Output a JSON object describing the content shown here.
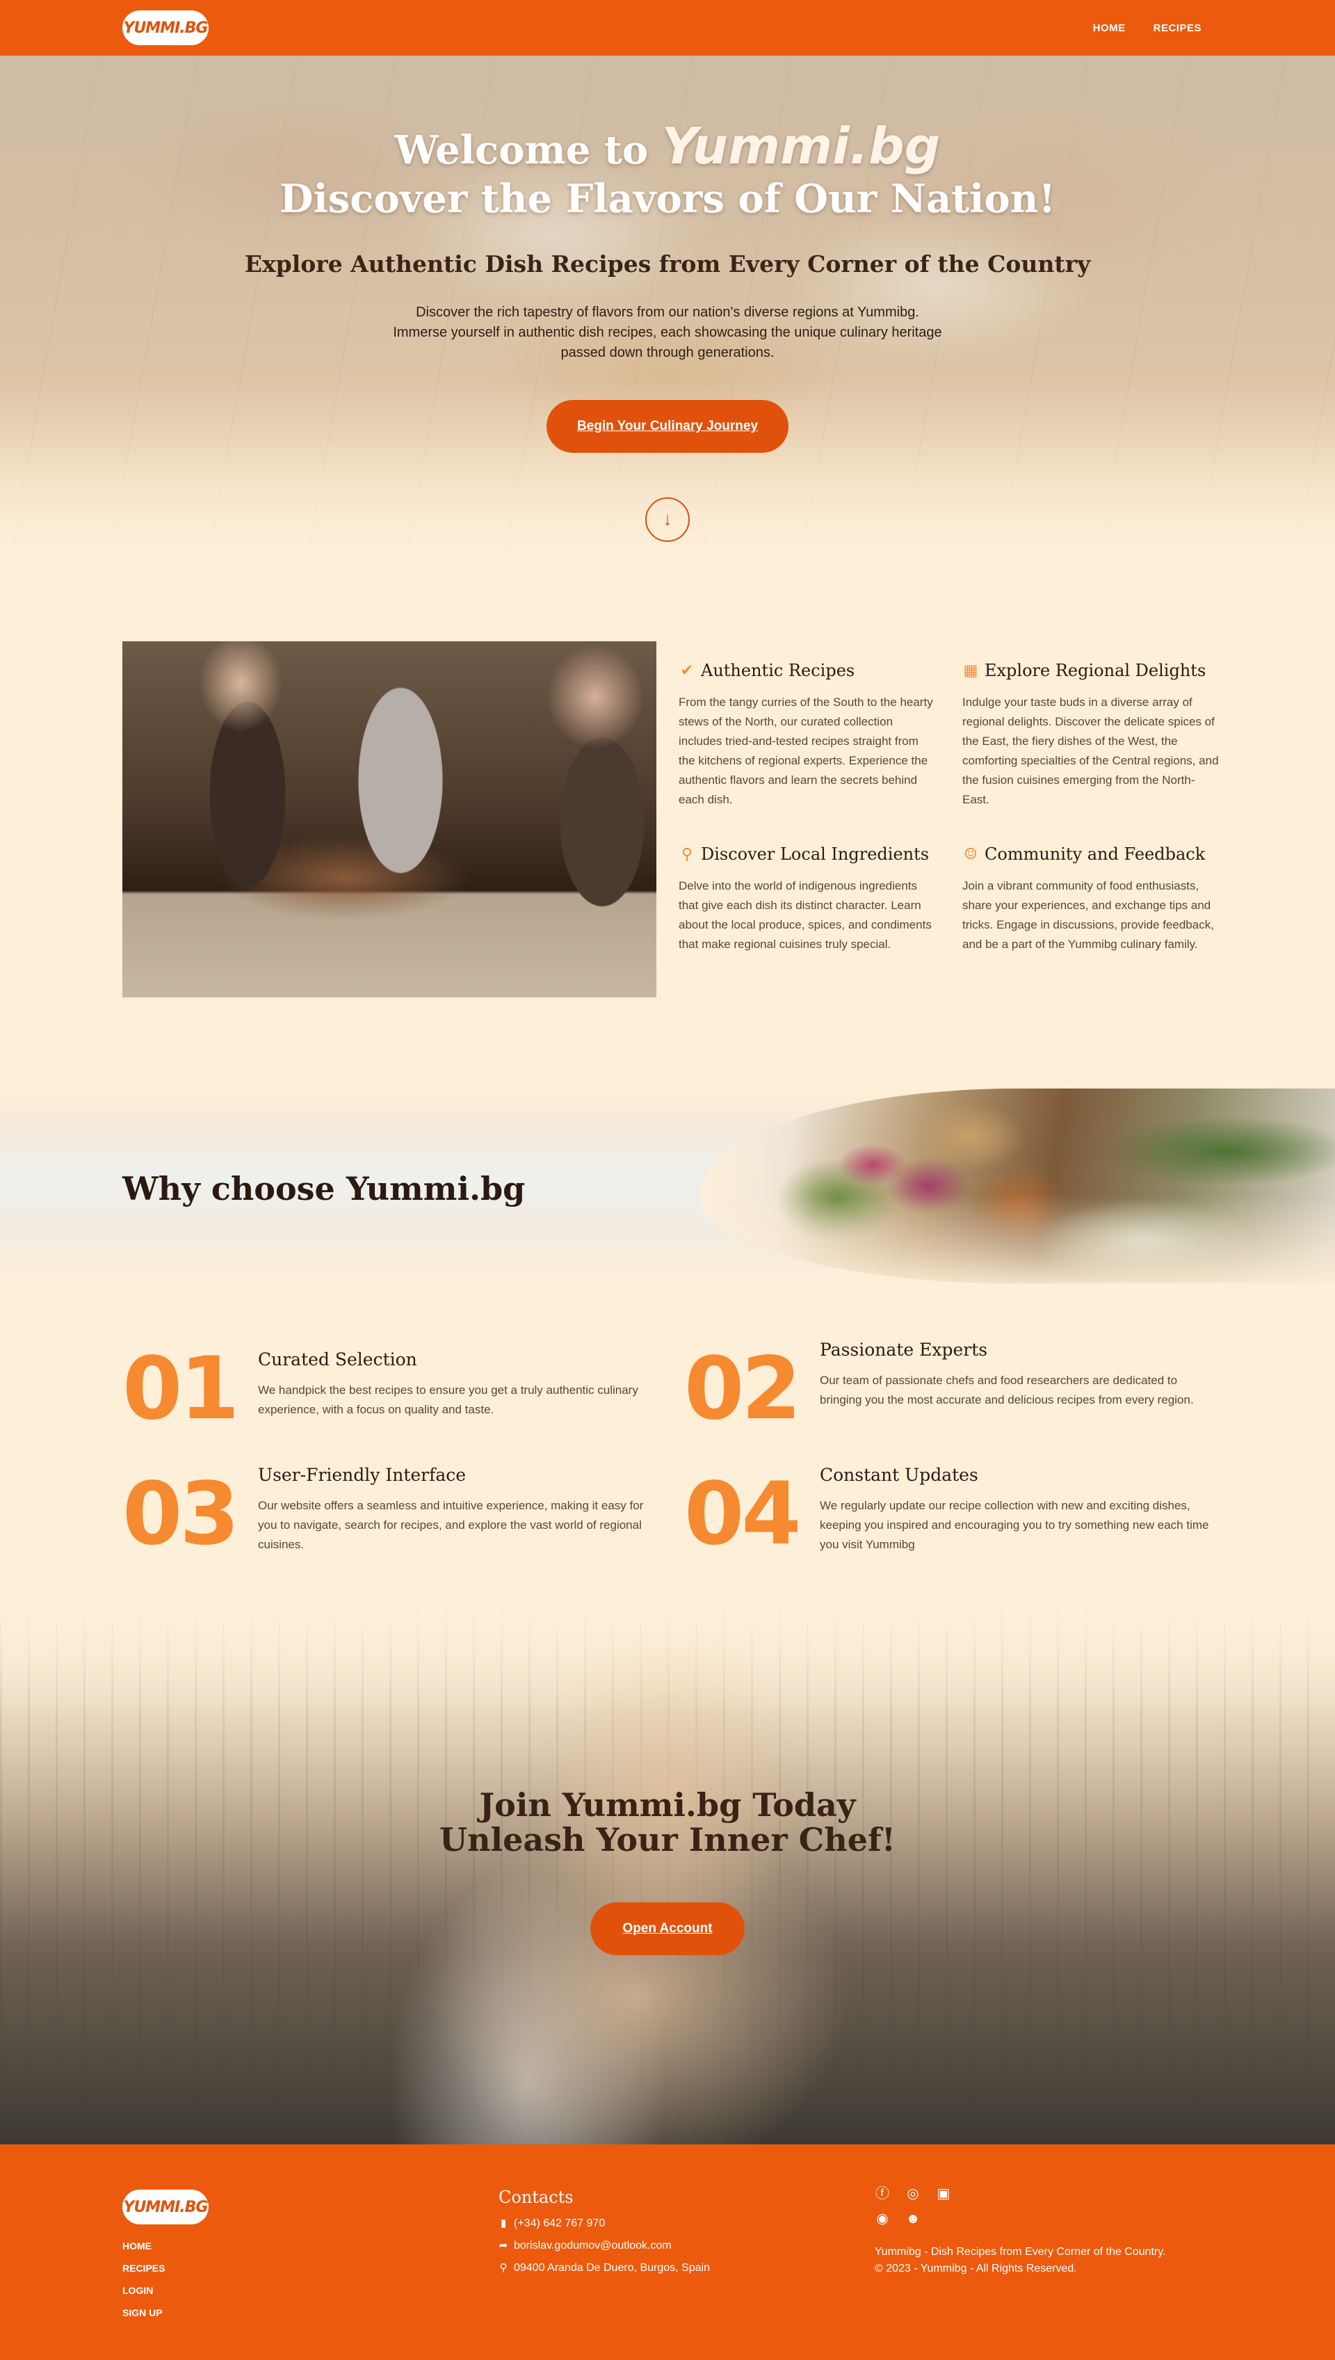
{
  "nav": {
    "logo": "YUMMI.BG",
    "links": [
      "HOME",
      "RECIPES"
    ]
  },
  "hero": {
    "title_prefix": "Welcome to",
    "brand": "Yummi.bg",
    "title_line2": "Discover the Flavors of Our Nation!",
    "subtitle": "Explore Authentic Dish Recipes from Every Corner of the Country",
    "description": "Discover the rich tapestry of flavors from our nation's diverse regions at Yummibg. Immerse yourself in authentic dish recipes, each showcasing the unique culinary heritage passed down through generations.",
    "cta": "Begin Your Culinary Journey",
    "scroll_icon": "arrow-down-icon"
  },
  "features": [
    {
      "icon": "check-badge-icon",
      "title": "Authentic Recipes",
      "text": "From the tangy curries of the South to the hearty stews of the North, our curated collection includes tried-and-tested recipes straight from the kitchens of regional experts. Experience the authentic flavors and learn the secrets behind each dish."
    },
    {
      "icon": "map-icon",
      "title": "Explore Regional Delights",
      "text": "Indulge your taste buds in a diverse array of regional delights. Discover the delicate spices of the East, the fiery dishes of the West, the comforting specialties of the Central regions, and the fusion cuisines emerging from the North-East."
    },
    {
      "icon": "map-pin-icon",
      "title": "Discover Local Ingredients",
      "text": "Delve into the world of indigenous ingredients that give each dish its distinct character. Learn about the local produce, spices, and condiments that make regional cuisines truly special."
    },
    {
      "icon": "people-icon",
      "title": "Community and Feedback",
      "text": "Join a vibrant community of food enthusiasts, share your experiences, and exchange tips and tricks. Engage in discussions, provide feedback, and be a part of the Yummibg culinary family."
    }
  ],
  "why": {
    "title": "Why choose Yummi.bg",
    "items": [
      {
        "num": "01",
        "title": "Curated Selection",
        "text": "We handpick the best recipes to ensure you get a truly authentic culinary experience, with a focus on quality and taste."
      },
      {
        "num": "02",
        "title": "Passionate Experts",
        "text": "Our team of passionate chefs and food researchers are dedicated to bringing you the most accurate and delicious recipes from every region."
      },
      {
        "num": "03",
        "title": "User-Friendly Interface",
        "text": "Our website offers a seamless and intuitive experience, making it easy for you to navigate, search for recipes, and explore the vast world of regional cuisines."
      },
      {
        "num": "04",
        "title": "Constant Updates",
        "text": "We regularly update our recipe collection with new and exciting dishes, keeping you inspired and encouraging you to try something new each time you visit Yummibg"
      }
    ]
  },
  "join": {
    "line1": "Join Yummi.bg Today",
    "line2": "Unleash Your Inner Chef!",
    "cta": "Open Account"
  },
  "footer": {
    "logo": "YUMMI.BG",
    "links": [
      "HOME",
      "RECIPES",
      "LOGIN",
      "SIGN UP"
    ],
    "contacts_title": "Contacts",
    "phone": "(+34) 642 767 970",
    "email": "borislav.godumov@outlook.com",
    "address": "09400 Aranda De Duero, Burgos, Spain",
    "social_icons": [
      "facebook-icon",
      "instagram-icon",
      "linkedin-icon",
      "github-icon",
      "discord-icon"
    ],
    "tagline": "Yummibg - Dish Recipes from Every Corner of the Country.",
    "copyright": "© 2023 - Yummibg - All Rights Reserved."
  },
  "colors": {
    "brand": "#ec5a0d",
    "accent": "#f58a30",
    "background": "#feefd8"
  }
}
